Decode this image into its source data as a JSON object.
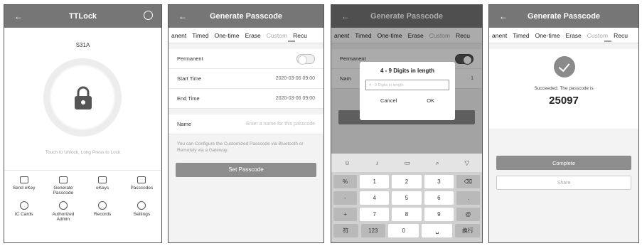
{
  "screen1": {
    "title": "TTLock",
    "lock_name": "S31A",
    "hint": "Touch to Unlock, Long Press to Lock",
    "grid": [
      {
        "label": "Send eKey",
        "icon": "send-ekey-icon"
      },
      {
        "label": "Generate Passcode",
        "icon": "generate-passcode-icon"
      },
      {
        "label": "eKeys",
        "icon": "ekeys-icon"
      },
      {
        "label": "Passcodes",
        "icon": "passcodes-icon"
      },
      {
        "label": "IC Cards",
        "icon": "ic-cards-icon"
      },
      {
        "label": "Authorized Admin",
        "icon": "authorized-admin-icon"
      },
      {
        "label": "Records",
        "icon": "records-icon"
      },
      {
        "label": "Settings",
        "icon": "settings-icon"
      }
    ]
  },
  "screen2": {
    "title": "Generate Passcode",
    "tabs": [
      "anent",
      "Timed",
      "One-time",
      "Erase",
      "Custom",
      "Recu"
    ],
    "permanent_label": "Permanent",
    "start_label": "Start Time",
    "start_value": "2020-03-06 09:00",
    "end_label": "End Time",
    "end_value": "2020-03-06 09:00",
    "name_label": "Name",
    "name_placeholder": "Enter a name for this passcode",
    "note": "You can Configure the Customized Passcode via Bluetooth or Remotely via a Gateway.",
    "button": "Set Passcode"
  },
  "screen3": {
    "title": "Generate Passcode",
    "tabs": [
      "anent",
      "Timed",
      "One-time",
      "Erase",
      "Custom",
      "Recu"
    ],
    "permanent_label": "Permanent",
    "name_label": "Nam",
    "dialog_title": "4 - 9 Digits in length",
    "dialog_placeholder": "4 - 9 Digits in length",
    "cancel": "Cancel",
    "ok": "OK",
    "button": "Set Passcode",
    "keys": [
      [
        "%",
        "1",
        "2",
        "3",
        "⌫"
      ],
      [
        "-",
        "4",
        "5",
        "6",
        "."
      ],
      [
        "+",
        "7",
        "8",
        "9",
        "@"
      ],
      [
        "符",
        "123",
        "0",
        "␣",
        "换行"
      ]
    ]
  },
  "screen4": {
    "title": "Generate Passcode",
    "tabs": [
      "anent",
      "Timed",
      "One-time",
      "Erase",
      "Custom",
      "Recu"
    ],
    "message": "Succeeded. The passcode is",
    "passcode": "25097",
    "complete": "Complete",
    "share": "Share"
  }
}
